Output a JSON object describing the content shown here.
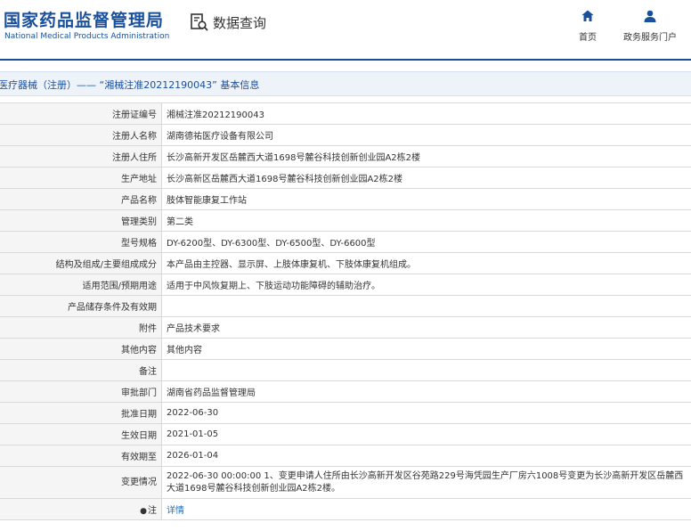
{
  "header": {
    "logo_cn": "国家药品监督管理局",
    "logo_en": "National Medical Products Administration",
    "query_label": "数据查询",
    "nav": [
      {
        "label": "首页",
        "icon": "home-icon"
      },
      {
        "label": "政务服务门户",
        "icon": "user-icon"
      }
    ]
  },
  "title": "医疗器械（注册）—— “湘械注准20212190043” 基本信息",
  "rows": [
    {
      "label": "注册证编号",
      "value": "湘械注准20212190043"
    },
    {
      "label": "注册人名称",
      "value": "湖南德祐医疗设备有限公司"
    },
    {
      "label": "注册人住所",
      "value": "长沙高新开发区岳麓西大道1698号麓谷科技创新创业园A2栋2楼"
    },
    {
      "label": "生产地址",
      "value": "长沙高新区岳麓西大道1698号麓谷科技创新创业园A2栋2楼"
    },
    {
      "label": "产品名称",
      "value": "肢体智能康复工作站"
    },
    {
      "label": "管理类别",
      "value": "第二类"
    },
    {
      "label": "型号规格",
      "value": "DY-6200型、DY-6300型、DY-6500型、DY-6600型"
    },
    {
      "label": "结构及组成/主要组成成分",
      "value": "本产品由主控器、显示屏、上肢体康复机、下肢体康复机组成。"
    },
    {
      "label": "适用范围/预期用途",
      "value": "适用于中风恢复期上、下肢运动功能障碍的辅助治疗。"
    },
    {
      "label": "产品储存条件及有效期",
      "value": ""
    },
    {
      "label": "附件",
      "value": "产品技术要求"
    },
    {
      "label": "其他内容",
      "value": "其他内容"
    },
    {
      "label": "备注",
      "value": ""
    },
    {
      "label": "审批部门",
      "value": "湖南省药品监督管理局"
    },
    {
      "label": "批准日期",
      "value": "2022-06-30"
    },
    {
      "label": "生效日期",
      "value": "2021-01-05"
    },
    {
      "label": "有效期至",
      "value": "2026-01-04"
    },
    {
      "label": "变更情况",
      "value": "2022-06-30 00:00:00 1、变更申请人住所由长沙高新开发区谷苑路229号海凭园生产厂房六1008号变更为长沙高新开发区岳麓西大道1698号麓谷科技创新创业园A2栋2楼。"
    },
    {
      "label": "注",
      "value": "详情",
      "link": true
    }
  ],
  "colors": {
    "brand": "#1a4f9c",
    "link": "#1a6fc2",
    "label_bg": "#f5f5f5",
    "title_bg": "#eef3f9"
  }
}
